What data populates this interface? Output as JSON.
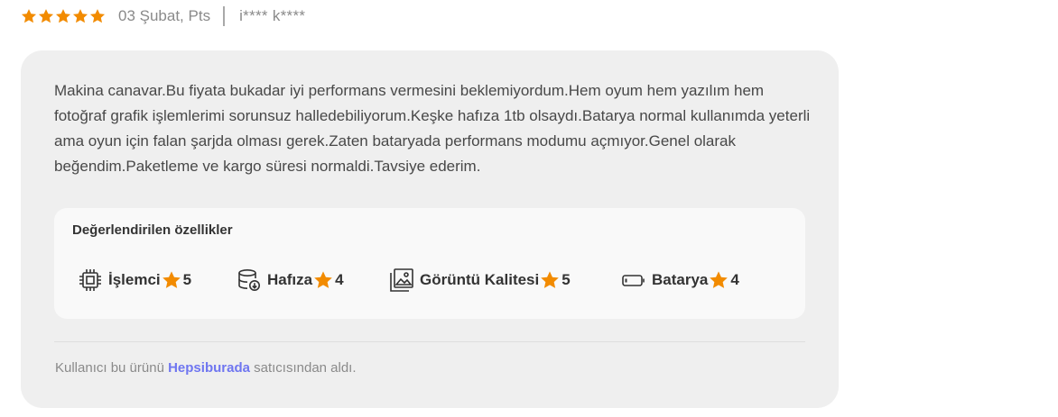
{
  "review": {
    "rating": 5,
    "max_rating": 5,
    "date": "03 Şubat, Pts",
    "user": "i**** k****",
    "text": "Makina canavar.Bu fiyata bukadar iyi performans vermesini beklemiyordum.Hem oyum hem yazılım hem fotoğraf grafik işlemlerimi sorunsuz halledebiliyorum.Keşke hafıza 1tb olsaydı.Batarya normal kullanımda yeterli ama oyun için falan şarjda olması gerek.Zaten bataryada performans modumu açmıyor.Genel olarak beğendim.Paketleme ve kargo süresi normaldi.Tavsiye ederim."
  },
  "features": {
    "title": "Değerlendirilen özellikler",
    "items": [
      {
        "label": "İşlemci",
        "score": "5",
        "icon": "cpu-icon"
      },
      {
        "label": "Hafıza",
        "score": "4",
        "icon": "storage-icon"
      },
      {
        "label": "Görüntü Kalitesi",
        "score": "5",
        "icon": "image-icon"
      },
      {
        "label": "Batarya",
        "score": "4",
        "icon": "battery-icon"
      }
    ]
  },
  "seller": {
    "prefix": "Kullanıcı bu ürünü ",
    "name": "Hepsiburada",
    "suffix": " satıcısından aldı."
  },
  "colors": {
    "star": "#f28b00",
    "card_bg": "#efefef",
    "features_bg": "#f9f9f9",
    "seller_link": "#6f76f0"
  }
}
